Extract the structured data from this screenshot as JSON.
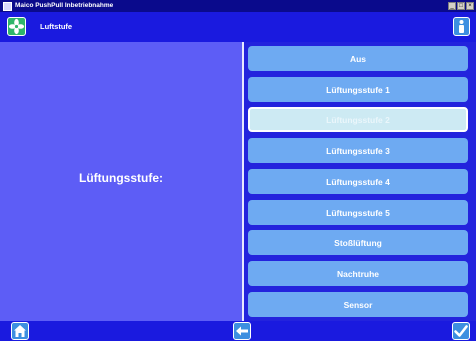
{
  "window": {
    "title": "Maico PushPull Inbetriebnahme",
    "controls": [
      "_",
      "□",
      "×"
    ]
  },
  "header": {
    "title": "Luftstufe",
    "left_icon": "fan-icon",
    "right_icon": "info-icon"
  },
  "left_panel": {
    "label": "Lüftungsstufe:"
  },
  "options": [
    {
      "label": "Aus",
      "selected": false
    },
    {
      "label": "Lüftungsstufe 1",
      "selected": false
    },
    {
      "label": "Lüftungsstufe 2",
      "selected": true
    },
    {
      "label": "Lüftungsstufe 3",
      "selected": false
    },
    {
      "label": "Lüftungsstufe 4",
      "selected": false
    },
    {
      "label": "Lüftungsstufe 5",
      "selected": false
    },
    {
      "label": "Stoßlüftung",
      "selected": false
    },
    {
      "label": "Nachtruhe",
      "selected": false
    },
    {
      "label": "Sensor",
      "selected": false
    }
  ],
  "footer": {
    "left_icon": "home-icon",
    "center_icon": "back-arrow-icon",
    "right_icon": "checkmark-icon"
  },
  "colors": {
    "background": "#2323dd",
    "left_panel": "#5d5df6",
    "option": "#6eaaf2",
    "option_selected": "#cdeaf3"
  }
}
